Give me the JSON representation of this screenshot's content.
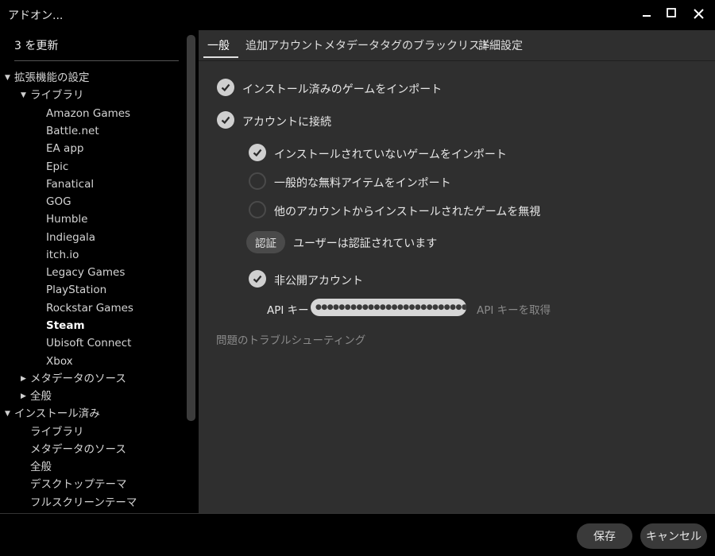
{
  "window": {
    "title": "アドオン...",
    "minimize": "_",
    "maximize": "☐",
    "close": "✕"
  },
  "sidebar": {
    "update_label": "3 を更新",
    "tree": [
      {
        "label": "拡張機能の設定",
        "arrow": "▼"
      },
      {
        "label": "ライブラリ",
        "arrow": "▼"
      },
      {
        "label": "Amazon Games"
      },
      {
        "label": "Battle.net"
      },
      {
        "label": "EA app"
      },
      {
        "label": "Epic"
      },
      {
        "label": "Fanatical"
      },
      {
        "label": "GOG"
      },
      {
        "label": "Humble"
      },
      {
        "label": "Indiegala"
      },
      {
        "label": "itch.io"
      },
      {
        "label": "Legacy Games"
      },
      {
        "label": "PlayStation"
      },
      {
        "label": "Rockstar Games"
      },
      {
        "label": "Steam",
        "selected": true
      },
      {
        "label": "Ubisoft Connect"
      },
      {
        "label": "Xbox"
      },
      {
        "label": "メタデータのソース",
        "arrow": "▶"
      },
      {
        "label": "全般",
        "arrow": "▶"
      },
      {
        "label": "インストール済み",
        "arrow": "▼"
      },
      {
        "label": "ライブラリ"
      },
      {
        "label": "メタデータのソース"
      },
      {
        "label": "全般"
      },
      {
        "label": "デスクトップテーマ"
      },
      {
        "label": "フルスクリーンテーマ"
      }
    ]
  },
  "tabs": [
    "一般",
    "追加アカウント",
    "メタデータ",
    "タグのブラックリスト",
    "詳細設定"
  ],
  "options": {
    "import_installed": {
      "label": "インストール済みのゲームをインポート",
      "checked": true
    },
    "connect_account": {
      "label": "アカウントに接続",
      "checked": true
    },
    "import_uninstalled": {
      "label": "インストールされていないゲームをインポート",
      "checked": true
    },
    "import_free_items": {
      "label": "一般的な無料アイテムをインポート",
      "checked": false
    },
    "ignore_other_accounts": {
      "label": "他のアカウントからインストールされたゲームを無視",
      "checked": false
    },
    "private_account": {
      "label": "非公開アカウント",
      "checked": true
    }
  },
  "auth": {
    "button_label": "認証",
    "status": "ユーザーは認証されています"
  },
  "api": {
    "label": "API キー",
    "value": "●●●●●●●●●●●●●●●●●●●●●●●●●●●●●",
    "link": "API キーを取得"
  },
  "troubleshoot": "問題のトラブルシューティング",
  "footer": {
    "save": "保存",
    "cancel": "キャンセル"
  },
  "colors": {
    "content_bg": "#2f2f2f",
    "sidebar_bg": "#000000",
    "check_fill": "#cfcfcf",
    "link": "#8a8a8a"
  }
}
